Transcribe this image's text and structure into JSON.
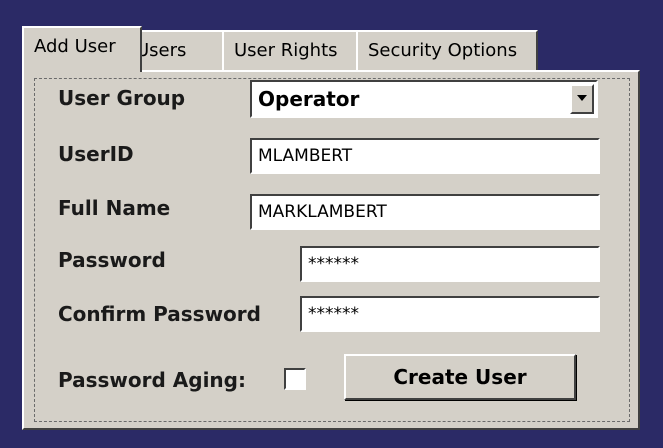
{
  "tabs": [
    {
      "label": "Add User",
      "active": true
    },
    {
      "label": "Users",
      "active": false
    },
    {
      "label": "User Rights",
      "active": false
    },
    {
      "label": "Security Options",
      "active": false
    }
  ],
  "form": {
    "user_group": {
      "label": "User Group",
      "value": "Operator"
    },
    "user_id": {
      "label": "UserID",
      "value": "MLAMBERT"
    },
    "full_name": {
      "label": "Full Name",
      "value": "MARKLAMBERT"
    },
    "password": {
      "label": "Password",
      "value": "******"
    },
    "confirm_password": {
      "label": "Confirm Password",
      "value": "******"
    },
    "password_aging": {
      "label": "Password Aging:",
      "checked": false
    }
  },
  "create_button_label": "Create User",
  "colors": {
    "background": "#2b2a66",
    "panel": "#d4d0c8",
    "field": "#ffffff"
  }
}
